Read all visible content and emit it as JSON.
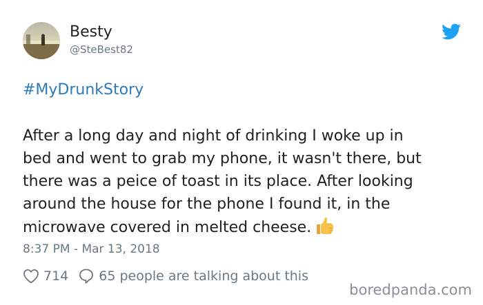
{
  "author": {
    "name": "Besty",
    "handle": "@SteBest82"
  },
  "tweet": {
    "hashtag": "#MyDrunkStory",
    "lines": [
      "After a long day and night of drinking I woke up in",
      "bed and went to grab my phone, it wasn't there, but",
      "there was a peice of toast in its place. After looking",
      "around the house for the phone I found it, in the",
      "microwave covered in melted cheese."
    ],
    "emoji": "thumbs-up-icon",
    "timestamp": "8:37 PM - Mar 13, 2018"
  },
  "engagement": {
    "likes": "714",
    "replies": "65",
    "talking_text": "people are talking about this"
  },
  "watermark": "boredpanda.com",
  "colors": {
    "link": "#2b7bb9",
    "text": "#1c2022",
    "muted": "#697882",
    "twitter_blue": "#1da1f2"
  }
}
